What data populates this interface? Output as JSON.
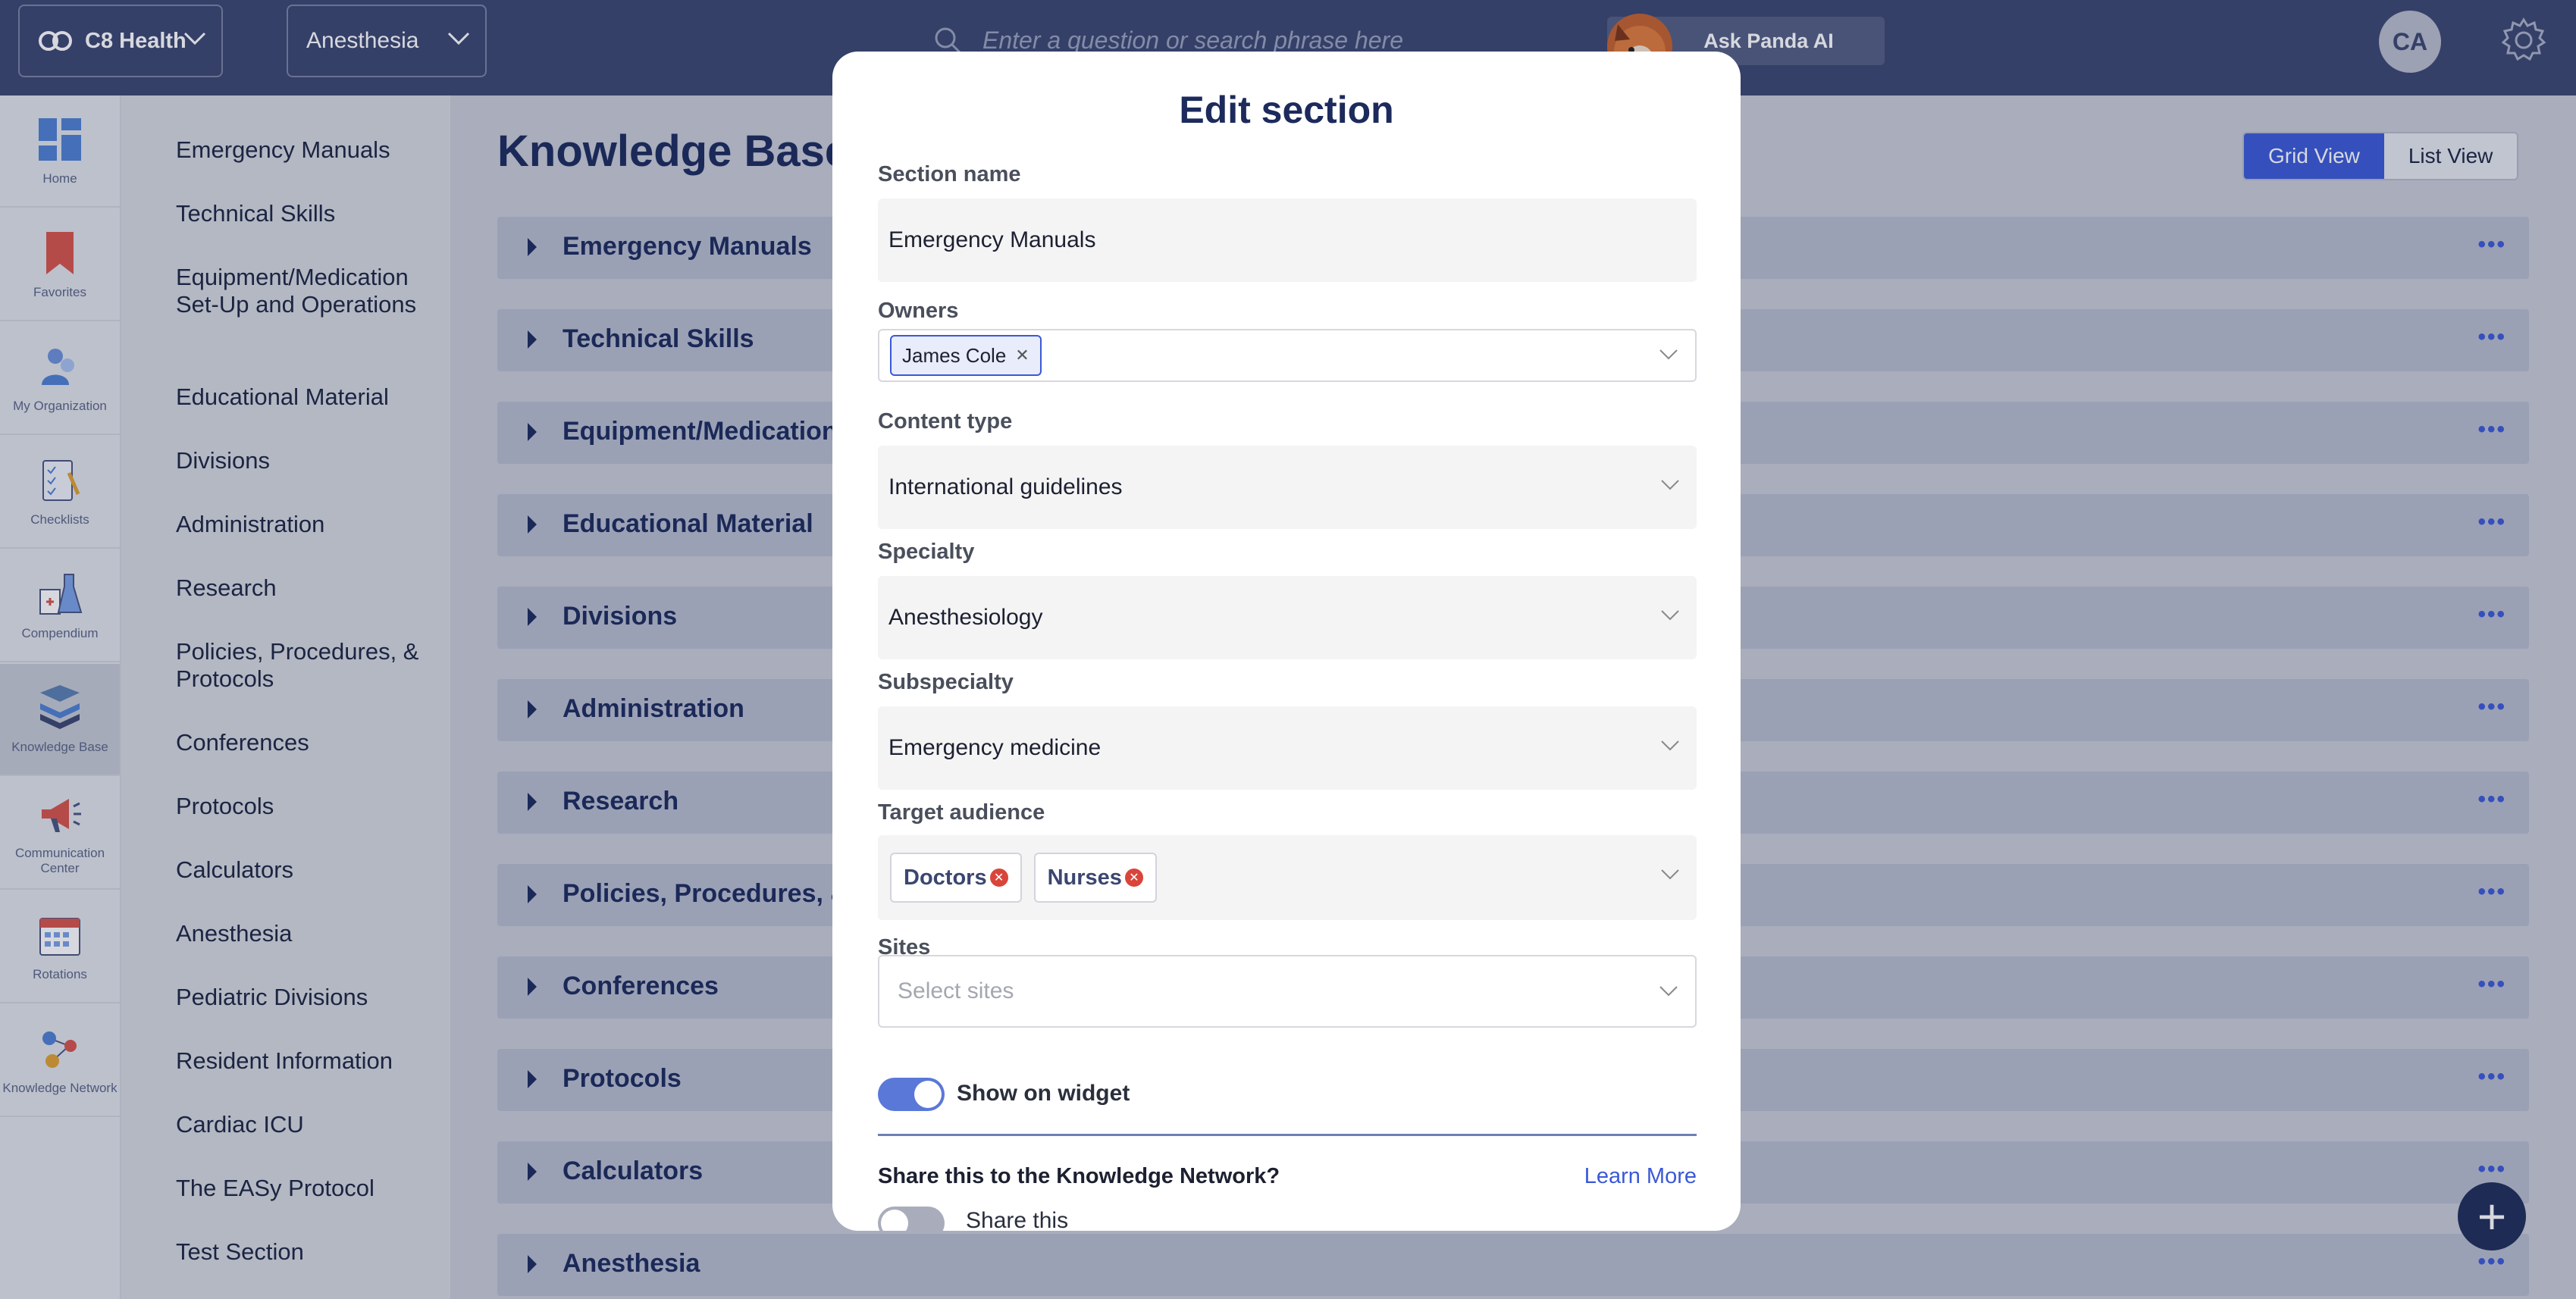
{
  "topbar": {
    "org_name": "C8 Health",
    "department": "Anesthesia",
    "search_placeholder": "Enter a question or search phrase here",
    "ask_panda_label": "Ask Panda AI",
    "avatar_initials": "CA"
  },
  "rail": {
    "items": [
      {
        "label": "Home",
        "icon": "home-grid-icon"
      },
      {
        "label": "Favorites",
        "icon": "bookmark-icon"
      },
      {
        "label": "My Organization",
        "icon": "people-icon"
      },
      {
        "label": "Checklists",
        "icon": "checklist-icon"
      },
      {
        "label": "Compendium",
        "icon": "flask-icon"
      },
      {
        "label": "Knowledge Base",
        "icon": "books-icon"
      },
      {
        "label": "Communication Center",
        "icon": "megaphone-icon"
      },
      {
        "label": "Rotations",
        "icon": "calendar-icon"
      },
      {
        "label": "Knowledge Network",
        "icon": "network-icon"
      }
    ]
  },
  "sections": {
    "items": [
      "Emergency Manuals",
      "Technical Skills",
      "Equipment/Medication Set-Up and Operations",
      "Educational Material",
      "Divisions",
      "Administration",
      "Research",
      "Policies, Procedures, & Protocols",
      "Conferences",
      "Protocols",
      "Calculators",
      "Anesthesia",
      "Pediatric Divisions",
      "Resident Information",
      "Cardiac ICU",
      "The EASy Protocol",
      "Test Section"
    ]
  },
  "main": {
    "title": "Knowledge Base",
    "grid_view_label": "Grid View",
    "list_view_label": "List View",
    "more_label": "•••",
    "fab_label": "+",
    "rows": [
      "Emergency Manuals",
      "Technical Skills",
      "Equipment/Medication",
      "Educational Material",
      "Divisions",
      "Administration",
      "Research",
      "Policies, Procedures, &",
      "Conferences",
      "Protocols",
      "Calculators",
      "Anesthesia"
    ]
  },
  "modal": {
    "title": "Edit section",
    "section_name_label": "Section name",
    "section_name_value": "Emergency Manuals",
    "owners_label": "Owners",
    "owners": [
      "James Cole"
    ],
    "content_type_label": "Content type",
    "content_type_value": "International guidelines",
    "specialty_label": "Specialty",
    "specialty_value": "Anesthesiology",
    "subspecialty_label": "Subspecialty",
    "subspecialty_value": "Emergency medicine",
    "target_audience_label": "Target audience",
    "target_audience": [
      "Doctors",
      "Nurses"
    ],
    "sites_label": "Sites",
    "sites_placeholder": "Select sites",
    "show_on_widget_label": "Show on widget",
    "show_on_widget": true,
    "share_question": "Share this to the Knowledge Network?",
    "learn_more_label": "Learn More",
    "share_this_label": "Share this",
    "share_this": false
  },
  "colors": {
    "topbar": "#3b4670",
    "accent": "#3b59d6",
    "title": "#1c2a5c",
    "tag_remove": "#d9453b"
  }
}
